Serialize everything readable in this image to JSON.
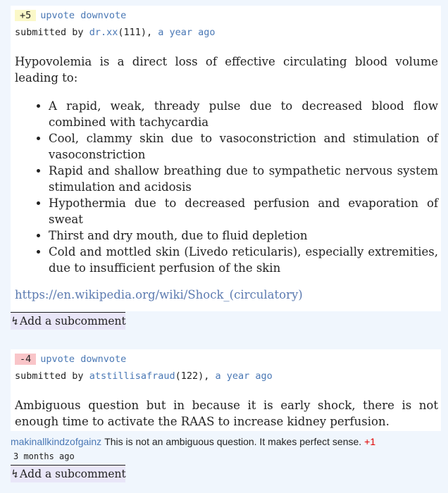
{
  "comments": [
    {
      "score": "+5",
      "upvote": "upvote",
      "downvote": "downvote",
      "submitted_by": "submitted by",
      "user": "dr.xx",
      "rep": "(111),",
      "time": "a year ago",
      "intro": "Hypovolemia is a direct loss of effective circulating blood volume leading to:",
      "bullets": [
        "A rapid, weak, thready pulse due to decreased blood flow combined with tachycardia",
        "Cool, clammy skin due to vasoconstriction and stimulation of vasoconstriction",
        "Rapid and shallow breathing due to sympathetic nervous system stimulation and acidosis",
        "Hypothermia due to decreased perfusion and evaporation of sweat",
        "Thirst and dry mouth, due to fluid depletion",
        "Cold and mottled skin (Livedo reticularis), especially extremities, due to insufficient perfusion of the skin"
      ],
      "link": "https://en.wikipedia.org/wiki/Shock_(circulatory)",
      "add_subcomment": "↯Add a subcomment"
    },
    {
      "score": "-4",
      "upvote": "upvote",
      "downvote": "downvote",
      "submitted_by": "submitted by",
      "user": "atstillisafraud",
      "rep": "(122),",
      "time": "a year ago",
      "text": "Ambiguous question but in because it is early shock, there is not enough time to activate the RAAS to increase kidney perfusion.",
      "subcomment": {
        "user": "makinallkindzofgainz",
        "text": "This is not an ambiguous question. It makes perfect sense.",
        "score": "+1",
        "time": "3 months ago"
      },
      "add_subcomment": "↯Add a subcomment"
    }
  ]
}
